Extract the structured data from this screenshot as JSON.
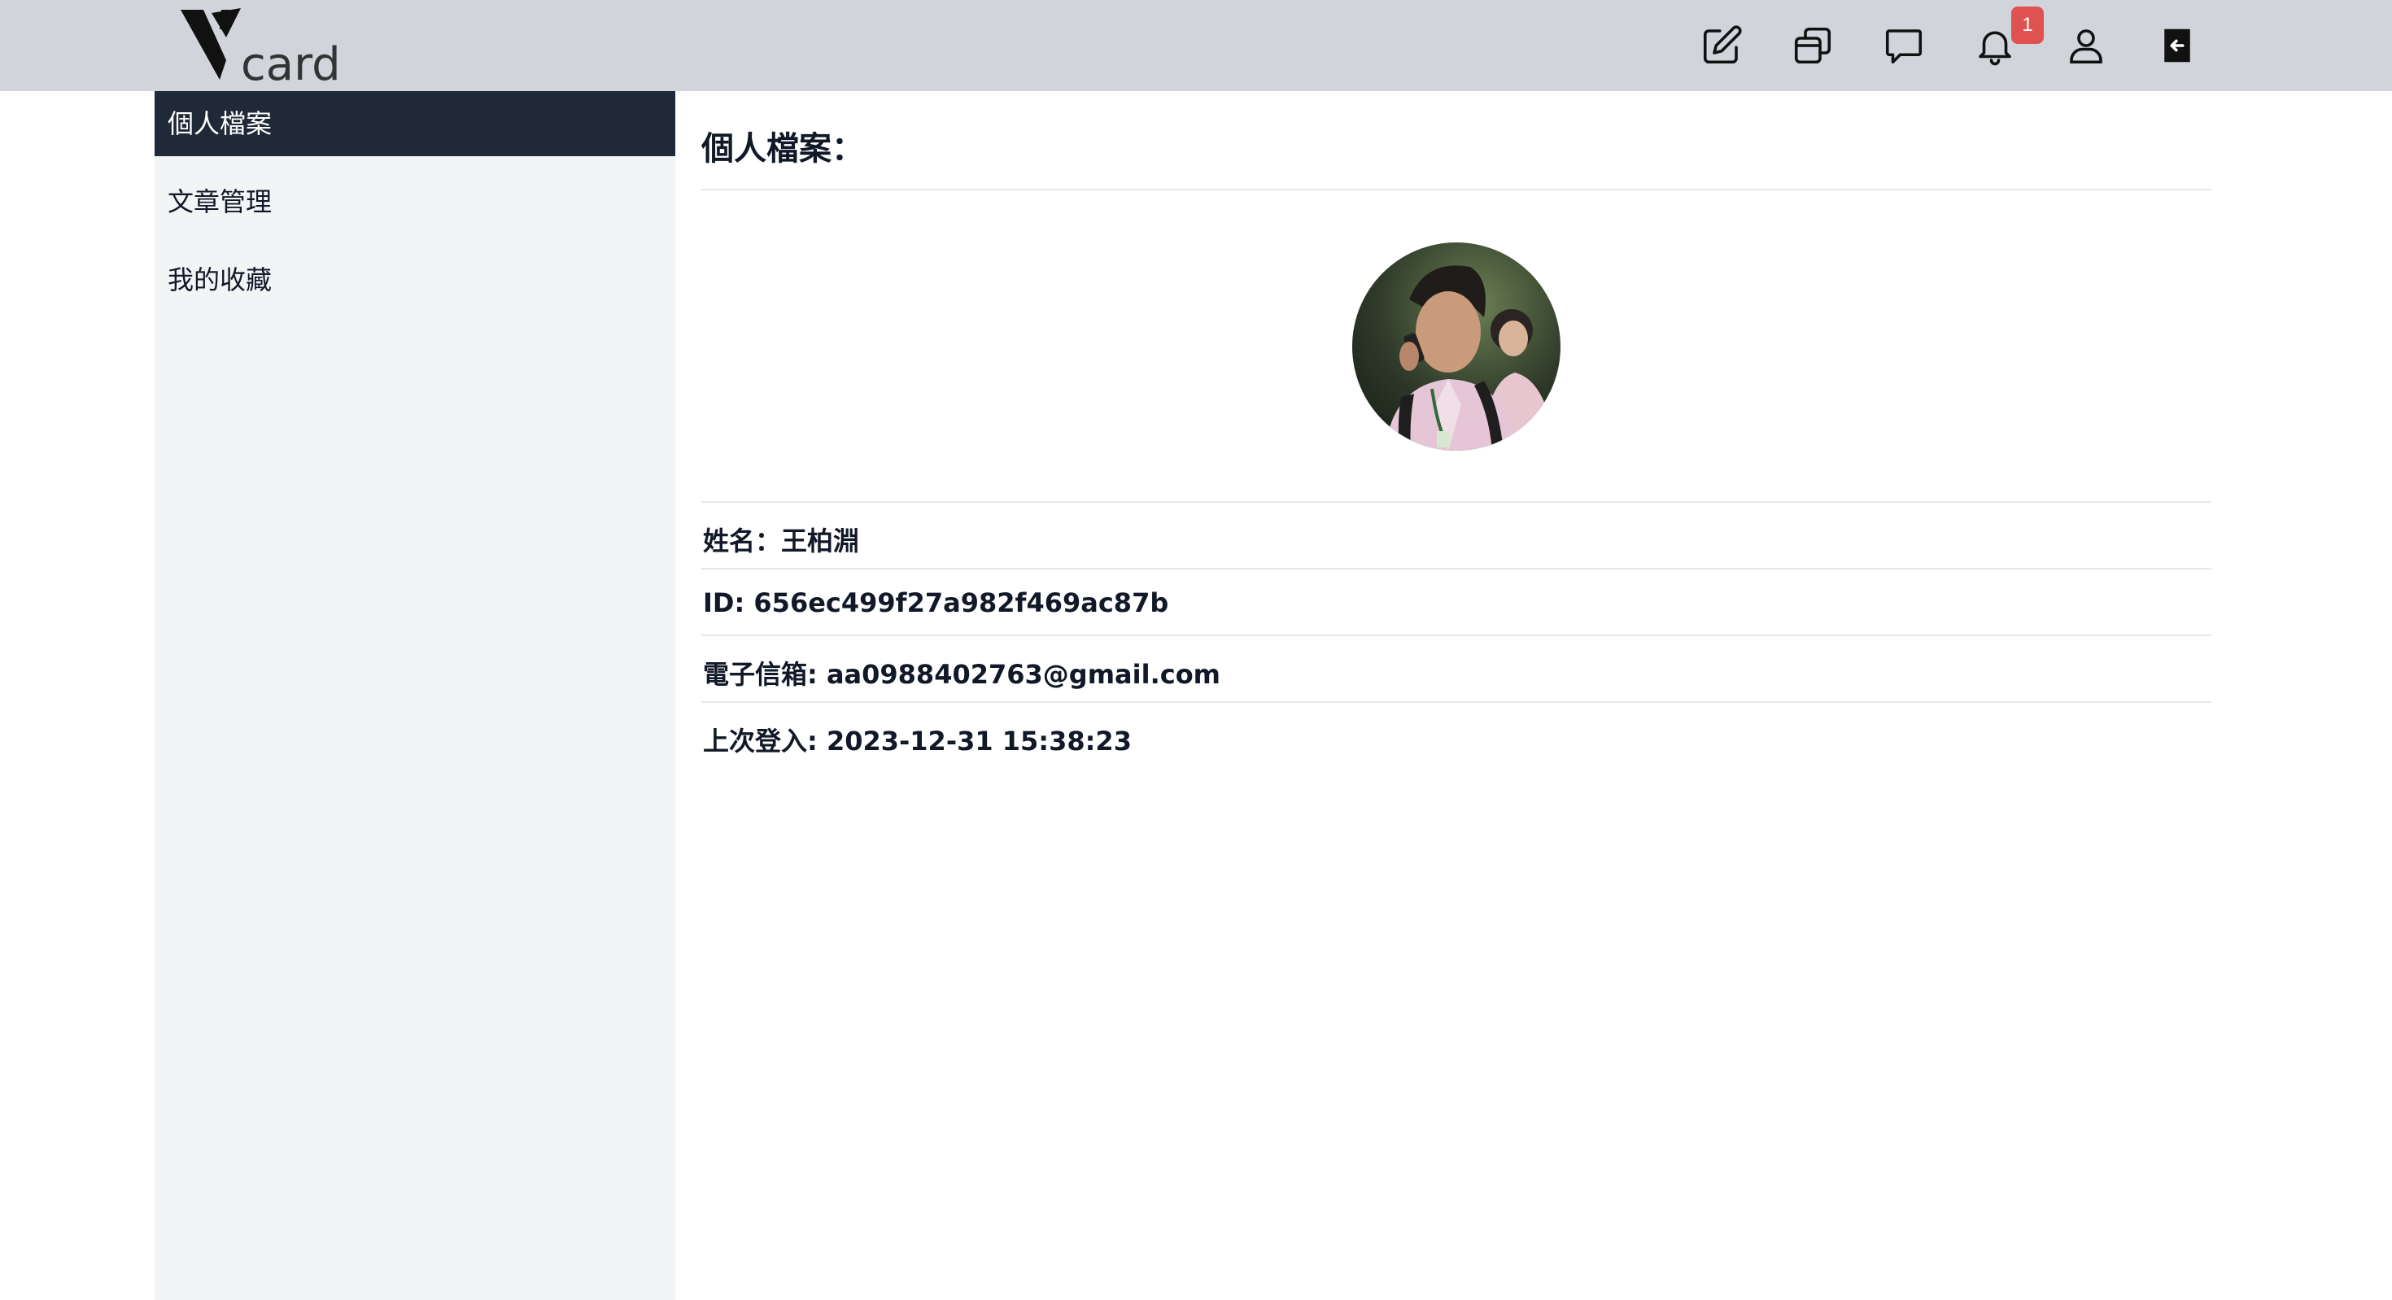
{
  "header": {
    "logo_text": "card",
    "icons": [
      "edit-icon",
      "copy-icon",
      "message-icon",
      "bell-icon",
      "user-icon",
      "logout-icon"
    ],
    "notification_count": "1",
    "colors": {
      "bar": "#d1d5db",
      "badge": "#e05252"
    }
  },
  "sidebar": {
    "items": [
      {
        "label": "個人檔案",
        "active": true
      },
      {
        "label": "文章管理",
        "active": false
      },
      {
        "label": "我的收藏",
        "active": false
      }
    ],
    "colors": {
      "background": "#f3f4f6",
      "active": "#1f2937"
    }
  },
  "profile": {
    "title": "個人檔案：",
    "name_label": "姓名：王柏淵",
    "id_label": "ID: 656ec499f27a982f469ac87b",
    "email_label": "電子信箱: aa0988402763@gmail.com",
    "last_login_label": "上次登入: 2023-12-31 15:38:23"
  }
}
